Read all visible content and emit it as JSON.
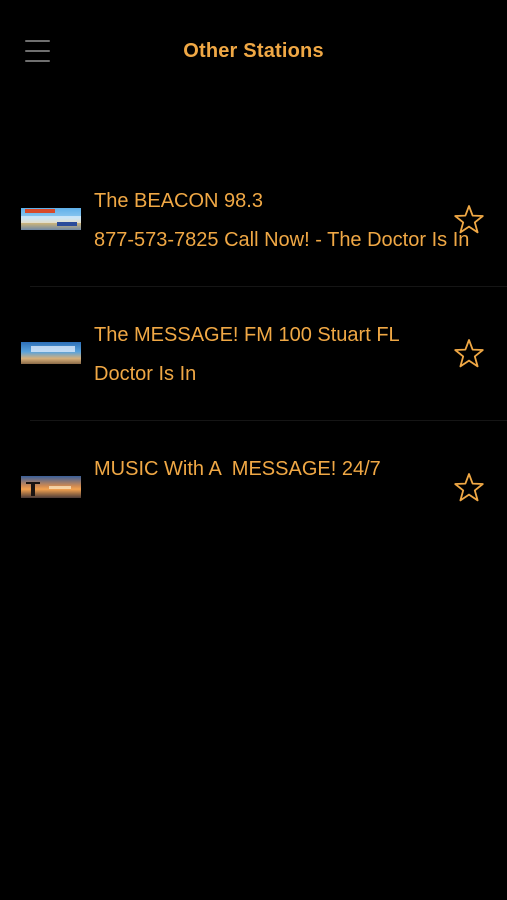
{
  "header": {
    "title": "Other Stations",
    "menu_icon": "hamburger-menu-icon"
  },
  "colors": {
    "background": "#000000",
    "accent": "#f0a845",
    "menu_icon": "#6f6f6f"
  },
  "stations": [
    {
      "title": "The BEACON 98.3",
      "subtitle": "877-573-7825 Call Now! - The Doctor Is In",
      "favorite_icon": "star-outline-icon",
      "favorited": false
    },
    {
      "title": "The MESSAGE! FM 100 Stuart FL",
      "subtitle": "Doctor Is In",
      "favorite_icon": "star-outline-icon",
      "favorited": false
    },
    {
      "title": "MUSIC With A  MESSAGE! 24/7",
      "subtitle": "",
      "favorite_icon": "star-outline-icon",
      "favorited": false
    }
  ]
}
